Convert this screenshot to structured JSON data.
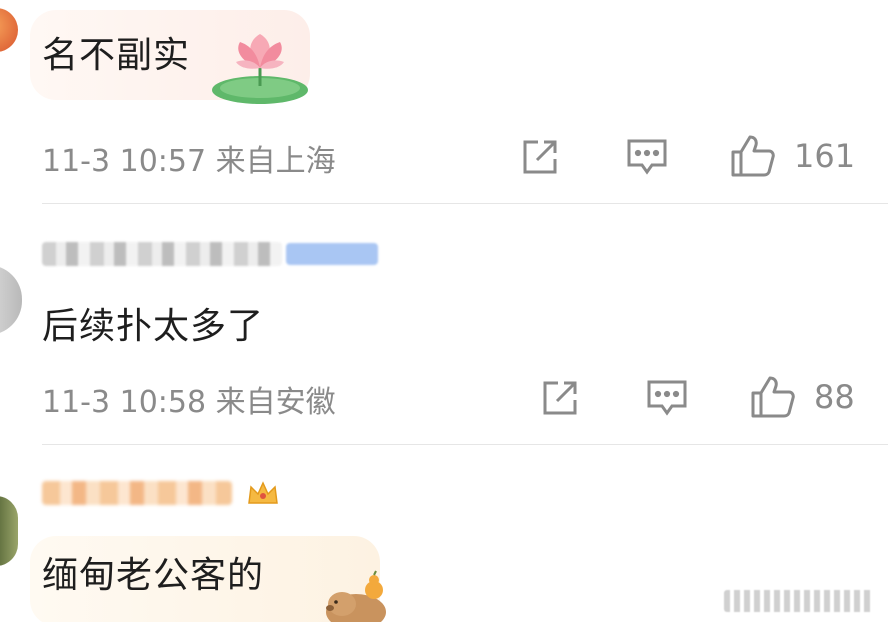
{
  "comments": [
    {
      "username": "",
      "text": "名不副实",
      "sticker": "lotus-sticker",
      "time": "11-3 10:57",
      "location": "来自上海",
      "likes": "161"
    },
    {
      "username": "",
      "text": "后续扑太多了",
      "time": "11-3 10:58",
      "location": "来自安徽",
      "likes": "88"
    },
    {
      "username": "",
      "text": "缅甸老公客的",
      "sticker": "capybara-sticker"
    }
  ],
  "icons": {
    "share": "share-icon",
    "reply": "comment-icon",
    "like": "thumbs-up-icon"
  },
  "colors": {
    "meta_text": "#8a8a8a",
    "divider": "#e6e6e6",
    "body_text": "#1e1e1e"
  }
}
